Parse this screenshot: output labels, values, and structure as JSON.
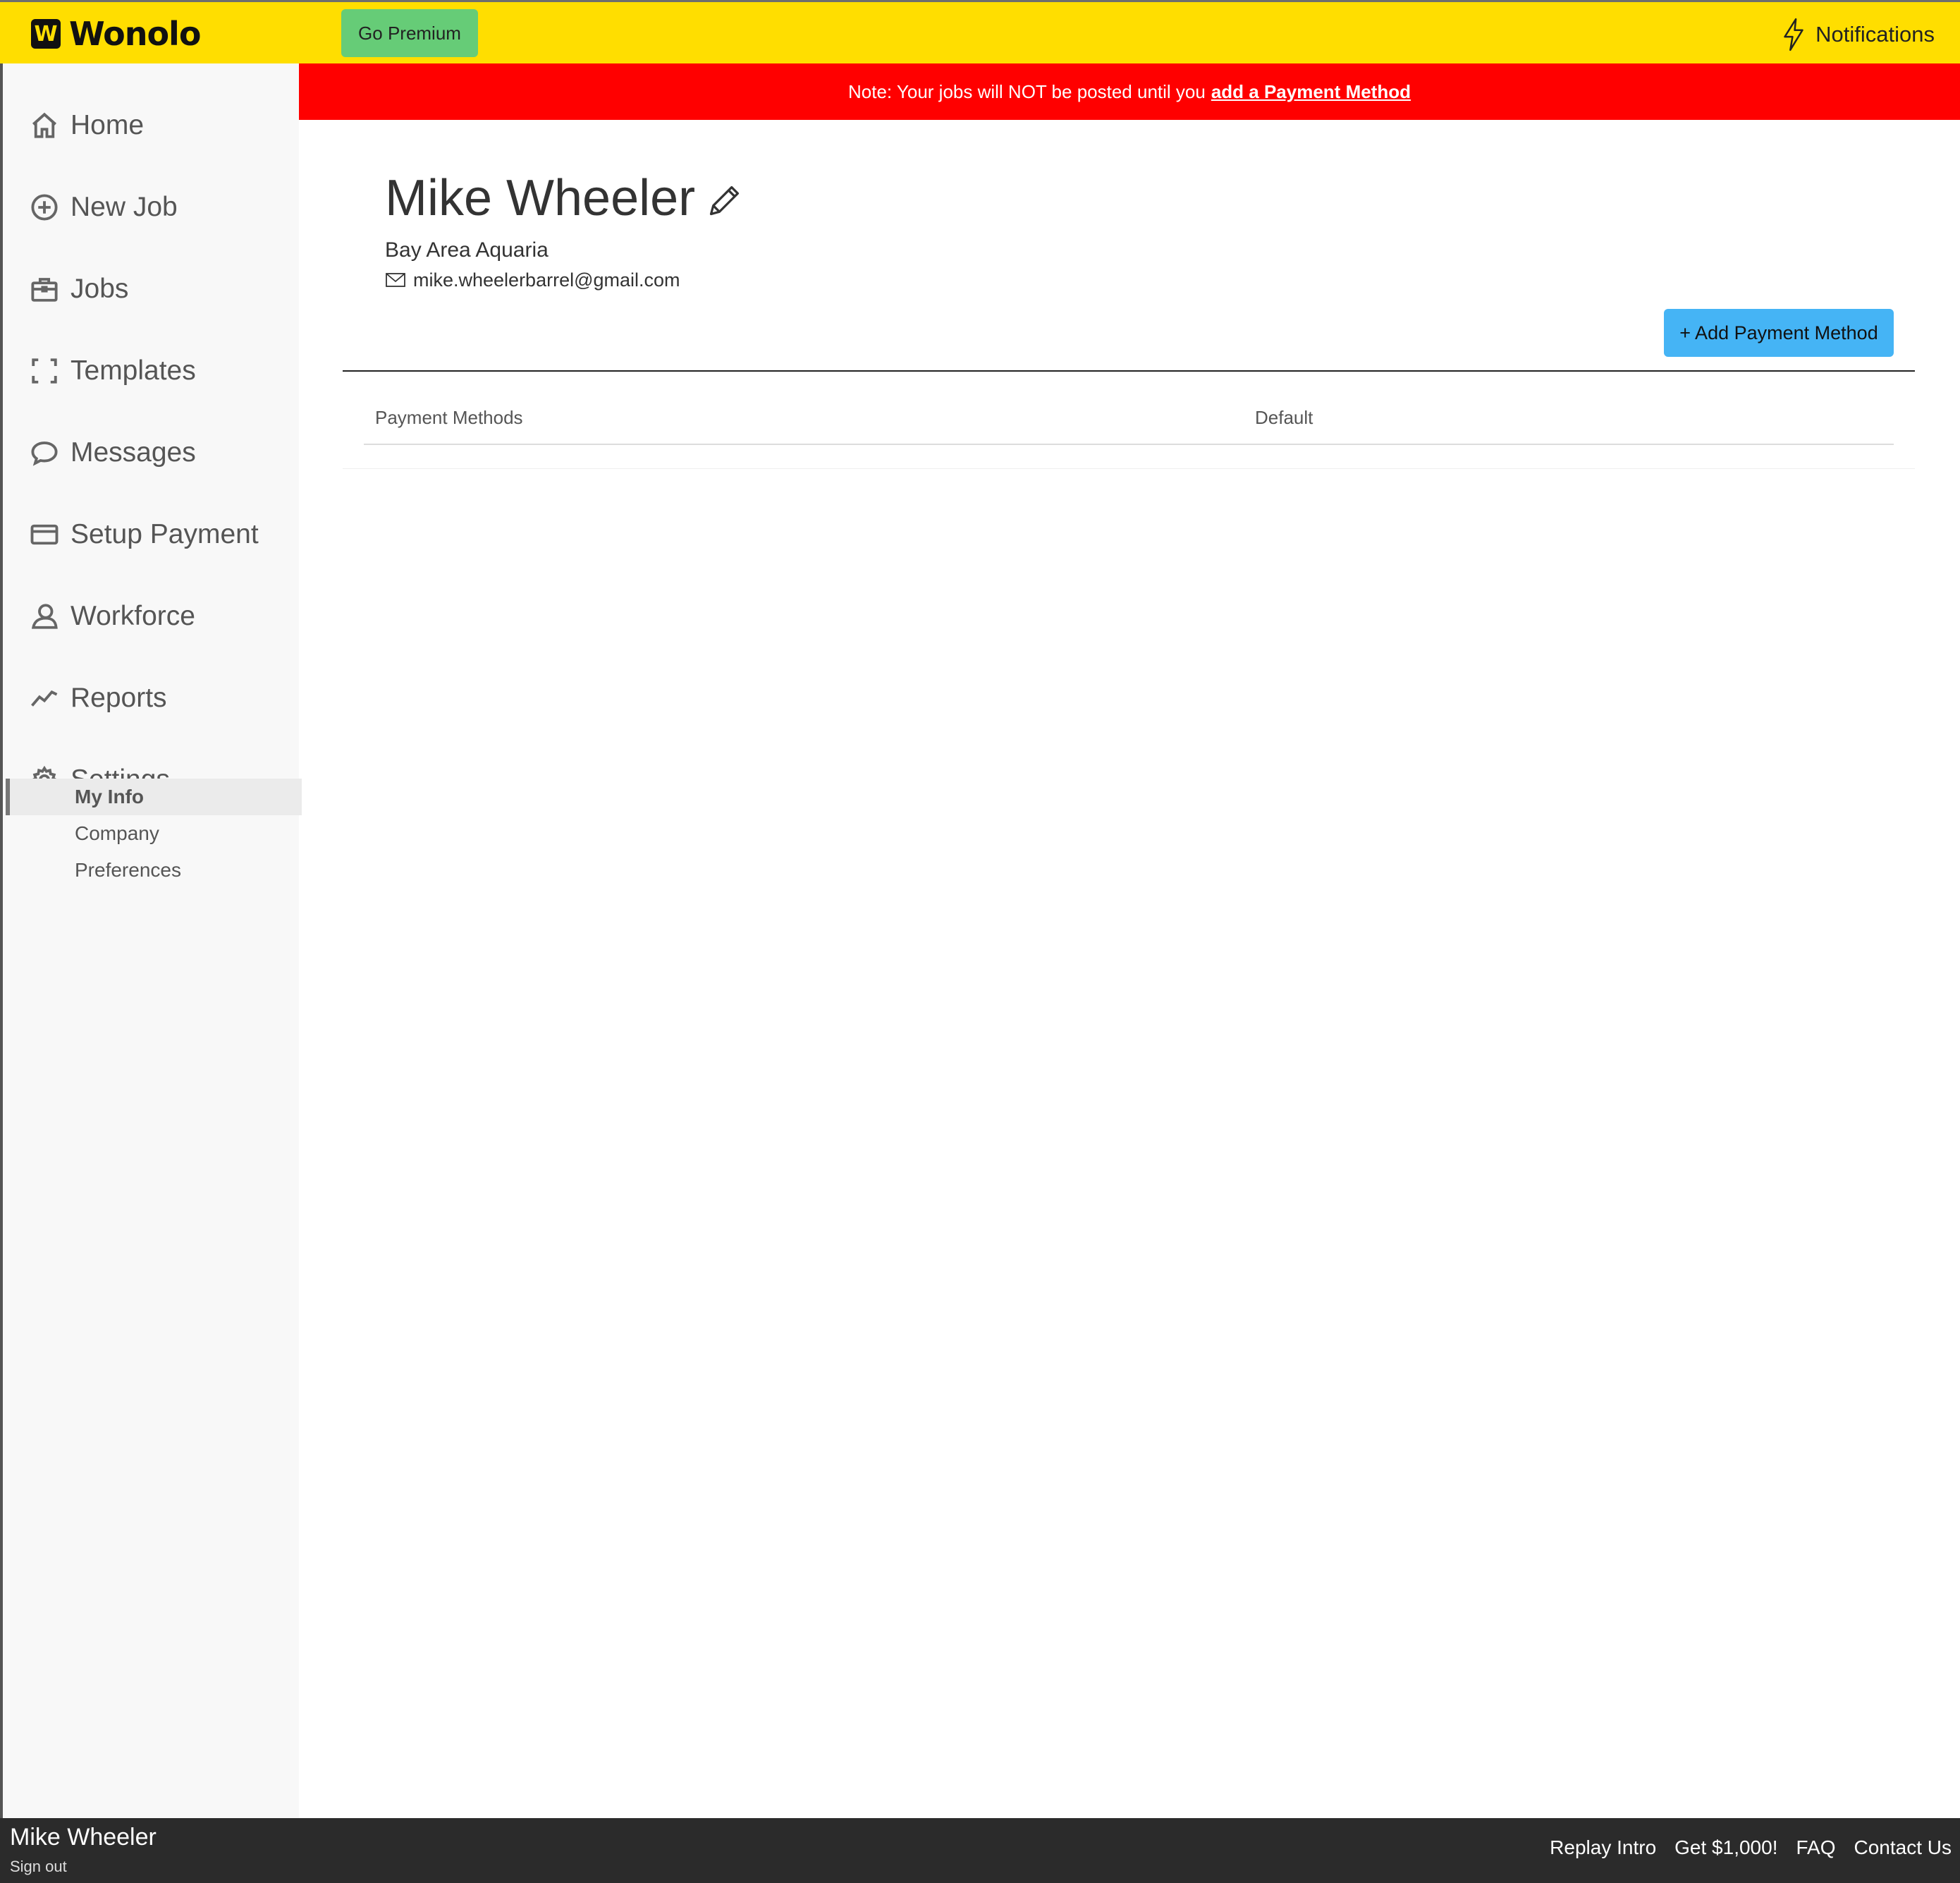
{
  "brand": {
    "name": "Wonolo",
    "mark": "W",
    "color": "#ffde00"
  },
  "topbar": {
    "premium_label": "Go Premium",
    "notifications_label": "Notifications"
  },
  "alert": {
    "prefix": "Note: Your jobs will NOT be posted until you",
    "link": "add a Payment Method",
    "color": "#ff0000"
  },
  "sidebar": {
    "items": [
      {
        "label": "Home",
        "icon": "home-icon"
      },
      {
        "label": "New Job",
        "icon": "plus-circle-icon"
      },
      {
        "label": "Jobs",
        "icon": "briefcase-icon"
      },
      {
        "label": "Templates",
        "icon": "frame-icon"
      },
      {
        "label": "Messages",
        "icon": "chat-bubble-icon"
      },
      {
        "label": "Setup Payment",
        "icon": "credit-card-icon"
      },
      {
        "label": "Workforce",
        "icon": "user-icon"
      },
      {
        "label": "Reports",
        "icon": "trend-line-icon"
      },
      {
        "label": "Settings",
        "icon": "gear-icon"
      }
    ],
    "settings_sub": [
      {
        "label": "My Info",
        "active": true
      },
      {
        "label": "Company",
        "active": false
      },
      {
        "label": "Preferences",
        "active": false
      }
    ]
  },
  "profile": {
    "name": "Mike Wheeler",
    "company": "Bay Area Aquaria",
    "email": "mike.wheelerbarrel@gmail.com"
  },
  "payment": {
    "add_label": "+ Add Payment Method",
    "button_color": "#45b4f5",
    "columns": [
      "Payment Methods",
      "Default"
    ],
    "rows": []
  },
  "footer": {
    "user_name": "Mike Wheeler",
    "sign_out": "Sign out",
    "links": [
      "Replay Intro",
      "Get $1,000!",
      "FAQ",
      "Contact Us"
    ]
  }
}
